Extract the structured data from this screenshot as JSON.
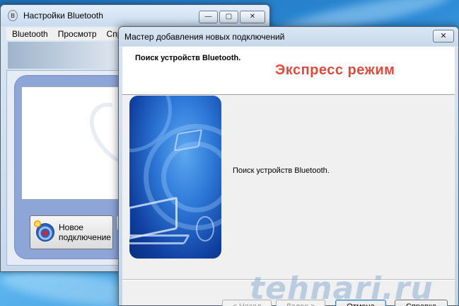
{
  "back_window": {
    "title": "Настройки Bluetooth",
    "controls": {
      "minimize": "—",
      "maximize": "▢",
      "close": "✕"
    },
    "menu": [
      "Bluetooth",
      "Просмотр",
      "Спр"
    ],
    "new_connection_line1": "Новое",
    "new_connection_line2": "подключение"
  },
  "wizard": {
    "title": "Мастер добавления новых подключений",
    "close": "✕",
    "header_title": "Поиск устройств Bluetooth.",
    "express_label": "Экспресс режим",
    "body_text": "Поиск устройств Bluetooth.",
    "buttons": {
      "back": "< Назад",
      "next": "Далее >",
      "cancel": "Отмена",
      "help": "Справка"
    }
  },
  "watermark": "tehnari.ru"
}
